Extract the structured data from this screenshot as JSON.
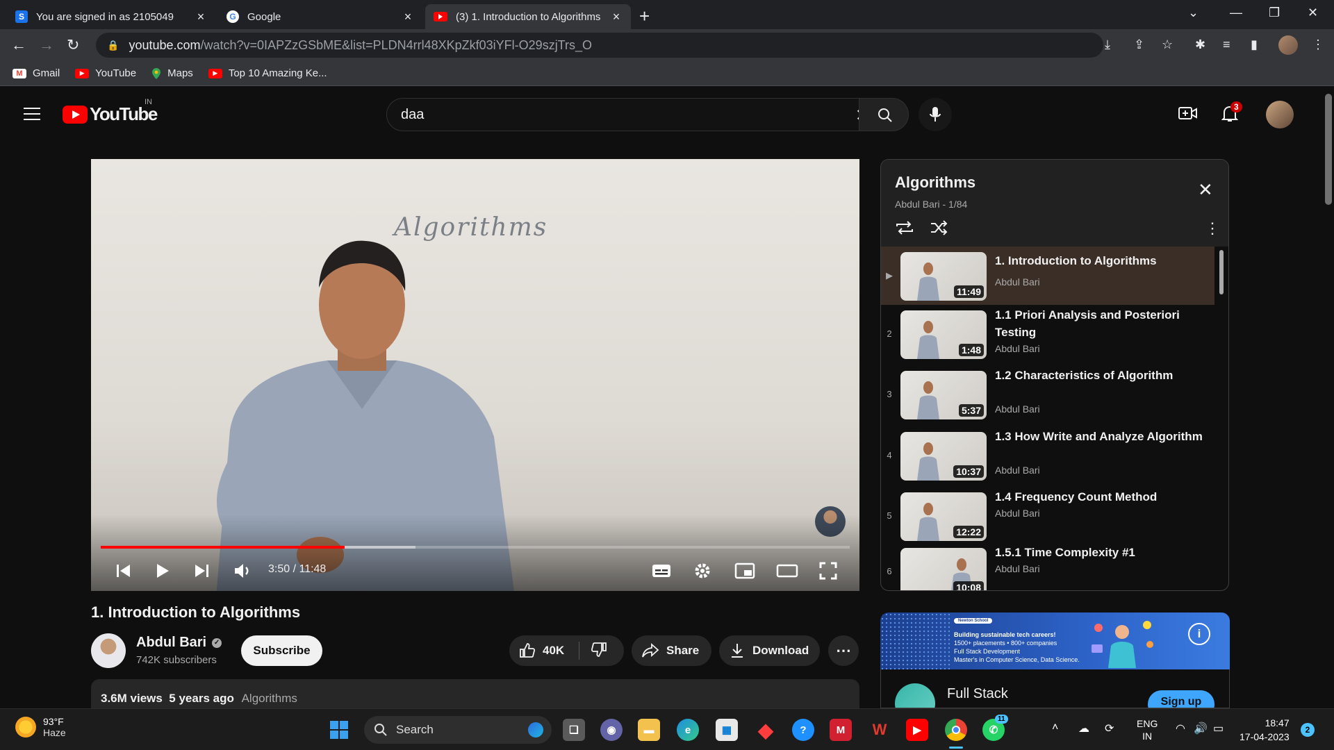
{
  "browser": {
    "tabs": [
      {
        "title": "You are signed in as 2105049",
        "favicon": "S"
      },
      {
        "title": "Google",
        "favicon": "G"
      },
      {
        "title": "(3) 1. Introduction to Algorithms",
        "favicon": "yt"
      }
    ],
    "url_domain": "youtube.com",
    "url_path": "/watch?v=0IAPZzGSbME&list=PLDN4rrl48XKpZkf03iYFl-O29szjTrs_O",
    "bookmarks": [
      "Gmail",
      "YouTube",
      "Maps",
      "Top 10 Amazing Ke..."
    ]
  },
  "header": {
    "logo_text": "YouTube",
    "country_code": "IN",
    "search_value": "daa",
    "notification_count": "3"
  },
  "player": {
    "whiteboard_text": "Algorithms",
    "time_current": "3:50",
    "time_total": "11:48",
    "time_display": "3:50 / 11:48",
    "progress_fraction": 0.3257,
    "buffered_fraction": 0.32
  },
  "video": {
    "title": "1. Introduction to Algorithms",
    "channel": "Abdul Bari",
    "subscribers": "742K subscribers",
    "subscribe_label": "Subscribe",
    "likes": "40K",
    "share_label": "Share",
    "download_label": "Download",
    "views": "3.6M views",
    "age": "5 years ago",
    "tag": "Algorithms"
  },
  "playlist": {
    "title": "Algorithms",
    "subtitle": "Abdul Bari - 1/84",
    "items": [
      {
        "index": "▶",
        "title": "1. Introduction to Algorithms",
        "channel": "Abdul Bari",
        "duration": "11:49",
        "current": true
      },
      {
        "index": "2",
        "title": "1.1 Priori Analysis and Posteriori Testing",
        "channel": "Abdul Bari",
        "duration": "1:48"
      },
      {
        "index": "3",
        "title": "1.2 Characteristics of Algorithm",
        "channel": "Abdul Bari",
        "duration": "5:37"
      },
      {
        "index": "4",
        "title": "1.3 How Write and Analyze Algorithm",
        "channel": "Abdul Bari",
        "duration": "10:37"
      },
      {
        "index": "5",
        "title": "1.4 Frequency Count Method",
        "channel": "Abdul Bari",
        "duration": "12:22"
      },
      {
        "index": "6",
        "title": "1.5.1 Time Complexity #1",
        "channel": "Abdul Bari",
        "duration": "10:08"
      }
    ]
  },
  "ad": {
    "brand": "Newton School",
    "line1": "Building sustainable tech careers!",
    "line2": "1500+ placements • 800+ companies",
    "line3": "Full Stack Development",
    "line4": "Master's in Computer Science, Data Science.",
    "title": "Full Stack",
    "cta": "Sign up"
  },
  "taskbar": {
    "temperature": "93°F",
    "condition": "Haze",
    "search_label": "Search",
    "whatsapp_badge": "11",
    "lang1": "ENG",
    "lang2": "IN",
    "time": "18:47",
    "date": "17-04-2023",
    "notifications": "2"
  },
  "colors": {
    "accent": "#ff0000",
    "bg": "#0f0f0f",
    "surface": "#272727",
    "link": "#3ea6ff"
  }
}
